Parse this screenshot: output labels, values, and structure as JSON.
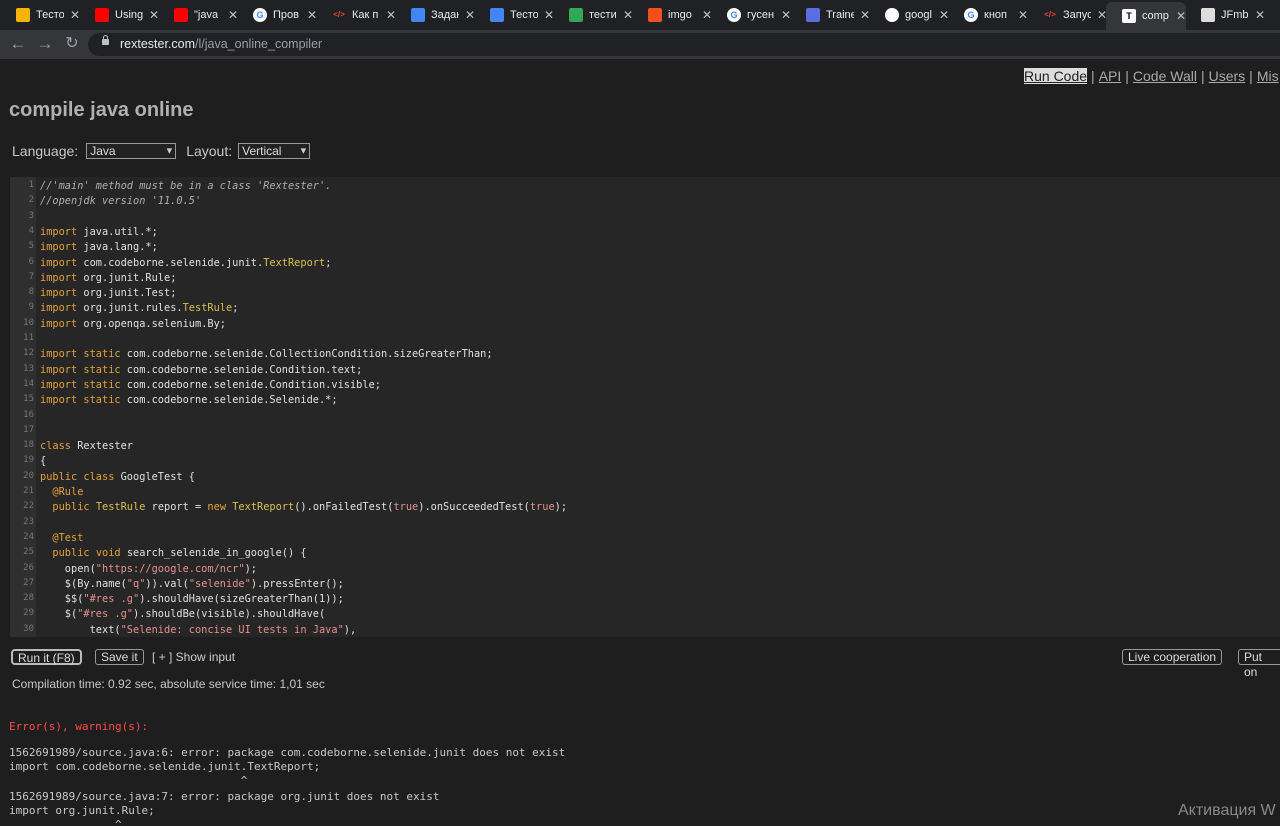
{
  "browser": {
    "tabs": [
      {
        "label": "Тесто",
        "icon": "google-drive-icon",
        "color": "#f4b400"
      },
      {
        "label": "Using",
        "icon": "youtube-icon",
        "color": "#ff0000"
      },
      {
        "label": "\"java",
        "icon": "youtube-icon",
        "color": "#ff0000"
      },
      {
        "label": "Пров",
        "icon": "google-icon",
        "color": "#ffffff"
      },
      {
        "label": "Как п",
        "icon": "code-icon",
        "color": "#ea4335"
      },
      {
        "label": "Задан",
        "icon": "google-docs-icon",
        "color": "#4285f4"
      },
      {
        "label": "Тесто",
        "icon": "google-docs-icon",
        "color": "#4285f4"
      },
      {
        "label": "тести",
        "icon": "leaf-icon",
        "color": "#34a853"
      },
      {
        "label": "imgo",
        "icon": "figma-icon",
        "color": "#f24e1e"
      },
      {
        "label": "гусен",
        "icon": "google-icon",
        "color": "#ffffff"
      },
      {
        "label": "Traine",
        "icon": "trainer-icon",
        "color": "#5b6ee1"
      },
      {
        "label": "googl",
        "icon": "github-icon",
        "color": "#ffffff"
      },
      {
        "label": "кноп",
        "icon": "google-icon",
        "color": "#ffffff"
      },
      {
        "label": "Запус",
        "icon": "code-icon",
        "color": "#ea4335"
      },
      {
        "label": "comp",
        "icon": "rextester-icon",
        "color": "#ffffff"
      },
      {
        "label": "JFmb",
        "icon": "jb-icon",
        "color": "#dddddd"
      }
    ],
    "url_host": "rextester.com",
    "url_path": "/l/java_online_compiler"
  },
  "nav": {
    "run_code": "Run Code",
    "api": "API",
    "code_wall": "Code Wall",
    "users": "Users",
    "misc": "Mis"
  },
  "page_title": "compile java online",
  "language": {
    "label": "Language:",
    "value": "Java"
  },
  "layout": {
    "label": "Layout:",
    "value": "Vertical"
  },
  "code_lines": [
    "//'main' method must be in a class 'Rextester'.",
    "//openjdk version '11.0.5'",
    "",
    "import java.util.*;",
    "import java.lang.*;",
    "import com.codeborne.selenide.junit.TextReport;",
    "import org.junit.Rule;",
    "import org.junit.Test;",
    "import org.junit.rules.TestRule;",
    "import org.openqa.selenium.By;",
    "",
    "import static com.codeborne.selenide.CollectionCondition.sizeGreaterThan;",
    "import static com.codeborne.selenide.Condition.text;",
    "import static com.codeborne.selenide.Condition.visible;",
    "import static com.codeborne.selenide.Selenide.*;",
    "",
    "",
    "class Rextester",
    "{",
    "public class GoogleTest {",
    "  @Rule",
    "  public TestRule report = new TextReport().onFailedTest(true).onSucceededTest(true);",
    "",
    "  @Test",
    "  public void search_selenide_in_google() {",
    "    open(\"https://google.com/ncr\");",
    "    $(By.name(\"q\")).val(\"selenide\").pressEnter();",
    "    $$(\"#res .g\").shouldHave(sizeGreaterThan(1));",
    "    $(\"#res .g\").shouldBe(visible).shouldHave(",
    "        text(\"Selenide: concise UI tests in Java\"),"
  ],
  "buttons": {
    "run": "Run it (F8)",
    "save": "Save it",
    "show_input": "[ + ] Show input",
    "live": "Live cooperation",
    "put_on": "Put on"
  },
  "compilation_time": "Compilation time: 0.92 sec, absolute service time: 1,01 sec",
  "errors_header": "Error(s), warning(s):",
  "output_lines": [
    "1562691989/source.java:6: error: package com.codeborne.selenide.junit does not exist",
    "import com.codeborne.selenide.junit.TextReport;",
    "                                   ^",
    "1562691989/source.java:7: error: package org.junit does not exist",
    "import org.junit.Rule;",
    "                ^"
  ],
  "watermark": "Активация W"
}
